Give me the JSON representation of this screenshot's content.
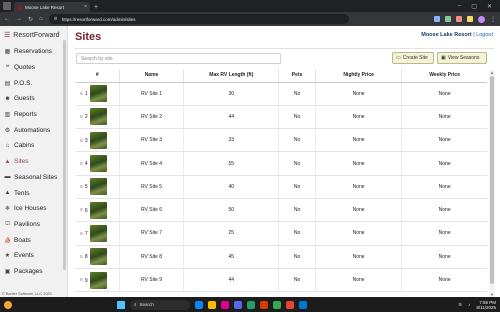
{
  "browser": {
    "tab_title": "Moose Lake Resort",
    "tab_close": "×",
    "new_tab": "+",
    "url": "https://resortforward.com/admin/sites",
    "window_controls": [
      "–",
      "▢",
      "✕"
    ]
  },
  "sidebar": {
    "brand": "ResortForward",
    "items": [
      {
        "label": "Reservations",
        "icon": "calendar-icon"
      },
      {
        "label": "Quotes",
        "icon": "quote-icon"
      },
      {
        "label": "P.O.S.",
        "icon": "register-icon"
      },
      {
        "label": "Guests",
        "icon": "users-icon"
      },
      {
        "label": "Reports",
        "icon": "report-icon"
      },
      {
        "label": "Automations",
        "icon": "gear-icon"
      },
      {
        "label": "Cabins",
        "icon": "cabin-icon"
      },
      {
        "label": "Sites",
        "icon": "tent-icon",
        "active": true
      },
      {
        "label": "Seasonal Sites",
        "icon": "rv-icon"
      },
      {
        "label": "Tents",
        "icon": "tent-icon"
      },
      {
        "label": "Ice Houses",
        "icon": "ice-icon"
      },
      {
        "label": "Pavilions",
        "icon": "pavilion-icon"
      },
      {
        "label": "Boats",
        "icon": "boat-icon"
      },
      {
        "label": "Events",
        "icon": "event-icon"
      },
      {
        "label": "Packages",
        "icon": "package-icon"
      }
    ],
    "copyright": "© Banter Software, LLC 2025"
  },
  "header": {
    "title": "Sites",
    "resort_name": "Moose Lake Resort",
    "separator": "|",
    "logout": "Logout"
  },
  "toolbar": {
    "search_placeholder": "Search by site.",
    "create_label": "Create Site",
    "seasons_label": "View Seasons"
  },
  "table": {
    "columns": [
      "#",
      "Name",
      "Max RV Length (ft)",
      "Pets",
      "Nightly Price",
      "Weekly Price"
    ],
    "rows": [
      {
        "num": "1",
        "name": "RV Site 1",
        "max_rv": "30",
        "pets": "No",
        "nightly": "None",
        "weekly": "None"
      },
      {
        "num": "2",
        "name": "RV Site 2",
        "max_rv": "44",
        "pets": "No",
        "nightly": "None",
        "weekly": "None"
      },
      {
        "num": "3",
        "name": "RV Site 3",
        "max_rv": "33",
        "pets": "No",
        "nightly": "None",
        "weekly": "None"
      },
      {
        "num": "4",
        "name": "RV Site 4",
        "max_rv": "55",
        "pets": "No",
        "nightly": "None",
        "weekly": "None"
      },
      {
        "num": "5",
        "name": "RV Site 5",
        "max_rv": "40",
        "pets": "No",
        "nightly": "None",
        "weekly": "None"
      },
      {
        "num": "6",
        "name": "RV Site 6",
        "max_rv": "50",
        "pets": "No",
        "nightly": "None",
        "weekly": "None"
      },
      {
        "num": "7",
        "name": "RV Site 7",
        "max_rv": "25",
        "pets": "No",
        "nightly": "None",
        "weekly": "None"
      },
      {
        "num": "8",
        "name": "RV Site 8",
        "max_rv": "45",
        "pets": "No",
        "nightly": "None",
        "weekly": "None"
      },
      {
        "num": "9",
        "name": "RV Site 9",
        "max_rv": "44",
        "pets": "No",
        "nightly": "None",
        "weekly": "None"
      }
    ]
  },
  "taskbar": {
    "search_label": "Search",
    "time": "7:55 PM",
    "date": "8/11/2025"
  },
  "colors": {
    "brand": "#7a1f2b",
    "active_nav": "#9b4a55",
    "button_bg": "#f3f3d8"
  }
}
